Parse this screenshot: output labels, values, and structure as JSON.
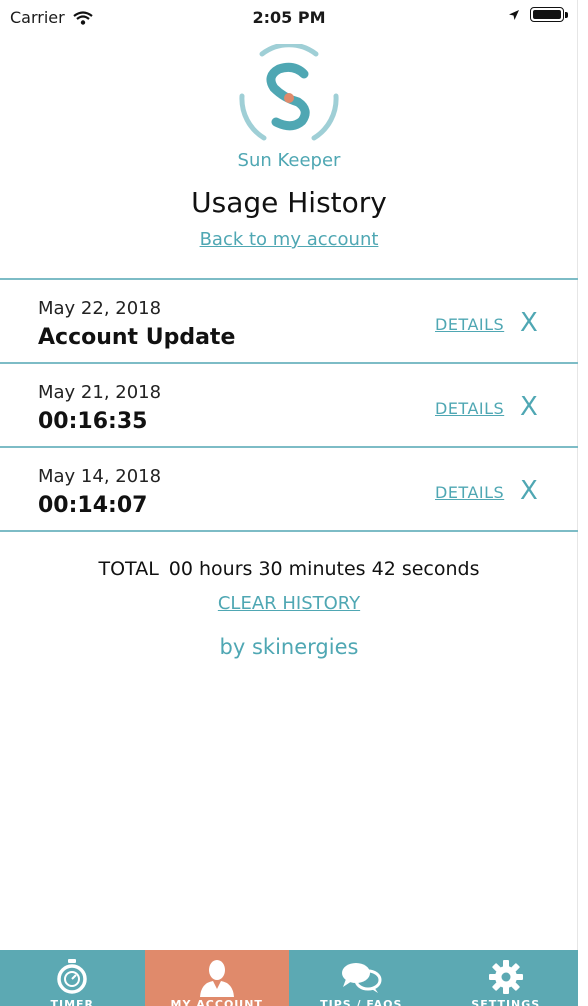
{
  "status_bar": {
    "carrier": "Carrier",
    "time": "2:05 PM"
  },
  "header": {
    "brand": "Sun Keeper",
    "title": "Usage History",
    "back_link": "Back to my account"
  },
  "history": [
    {
      "date": "May 22, 2018",
      "value": "Account Update",
      "details": "DETAILS",
      "remove": "X"
    },
    {
      "date": "May 21, 2018",
      "value": "00:16:35",
      "details": "DETAILS",
      "remove": "X"
    },
    {
      "date": "May 14, 2018",
      "value": "00:14:07",
      "details": "DETAILS",
      "remove": "X"
    }
  ],
  "summary": {
    "total_label": "TOTAL",
    "total_value": "00 hours 30 minutes 42 seconds",
    "clear_history": "CLEAR HISTORY",
    "footer": "by skinergies"
  },
  "tabs": [
    {
      "label": "TIMER",
      "icon": "stopwatch-icon"
    },
    {
      "label": "MY ACCOUNT",
      "icon": "user-icon",
      "active": true
    },
    {
      "label": "TIPS / FAQS",
      "icon": "chat-bubbles-icon"
    },
    {
      "label": "SETTINGS",
      "icon": "gear-icon"
    }
  ],
  "colors": {
    "accent": "#4fa7b3",
    "tab_bar": "#5ca9b3",
    "tab_active": "#e08a6b",
    "logo_dot": "#e08a6b"
  }
}
